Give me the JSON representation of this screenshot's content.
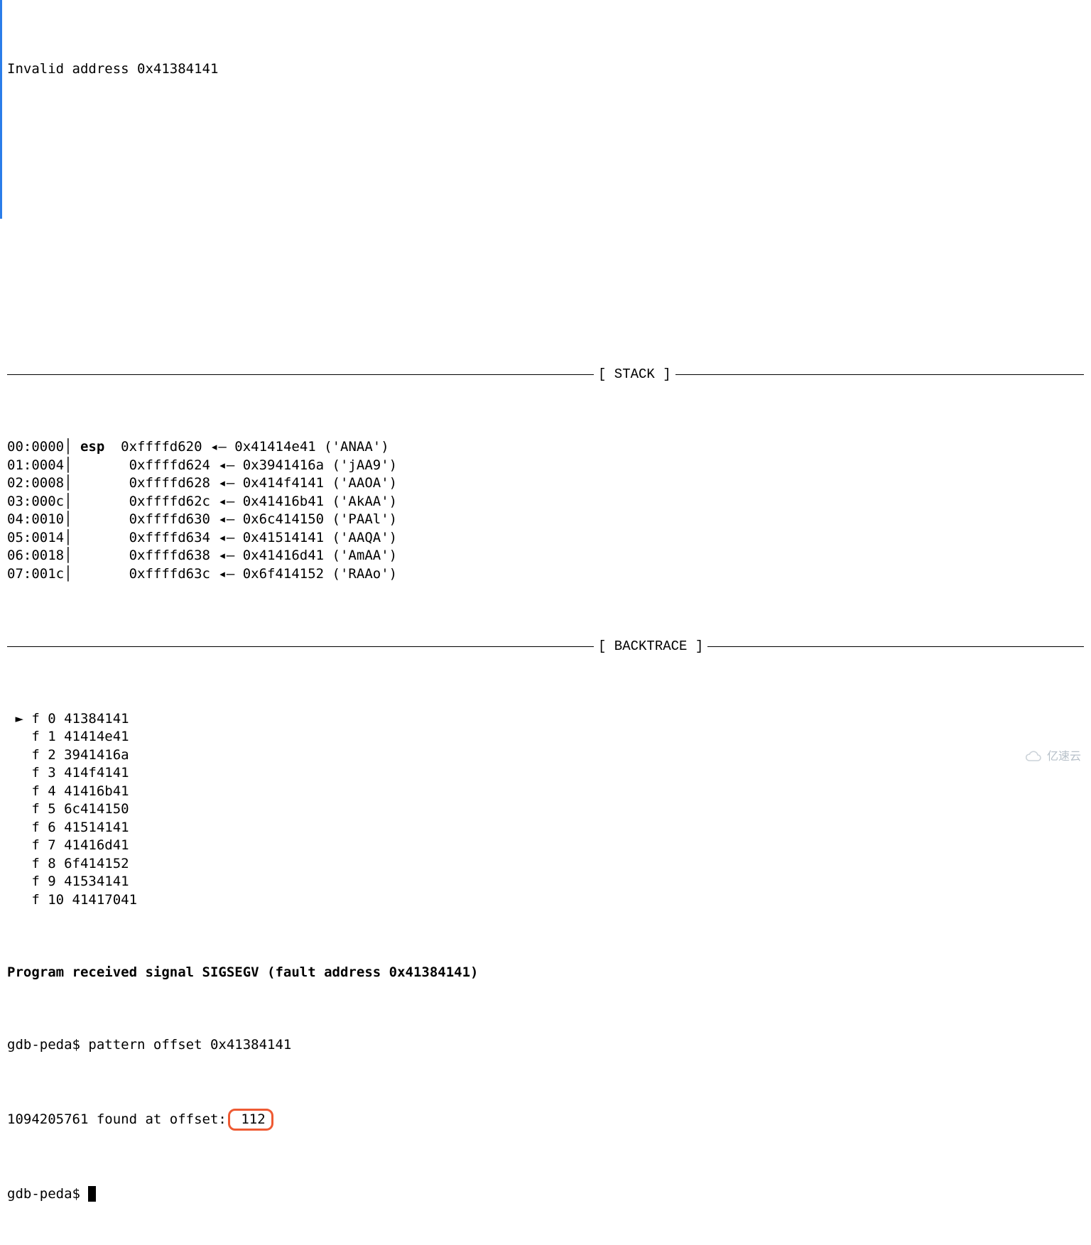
{
  "top": {
    "invalid_addr": "Invalid address 0x41384141"
  },
  "sections": {
    "stack": "[ STACK ]",
    "backtrace": "[ BACKTRACE ]"
  },
  "stack_reg": "esp",
  "stack_rows": [
    {
      "idx": "00:0000",
      "addr": "0xffffd620",
      "val": "0x41414e41",
      "ascii": "('ANAA')"
    },
    {
      "idx": "01:0004",
      "addr": "0xffffd624",
      "val": "0x3941416a",
      "ascii": "('jAA9')"
    },
    {
      "idx": "02:0008",
      "addr": "0xffffd628",
      "val": "0x414f4141",
      "ascii": "('AAOA')"
    },
    {
      "idx": "03:000c",
      "addr": "0xffffd62c",
      "val": "0x41416b41",
      "ascii": "('AkAA')"
    },
    {
      "idx": "04:0010",
      "addr": "0xffffd630",
      "val": "0x6c414150",
      "ascii": "('PAAl')"
    },
    {
      "idx": "05:0014",
      "addr": "0xffffd634",
      "val": "0x41514141",
      "ascii": "('AAQA')"
    },
    {
      "idx": "06:0018",
      "addr": "0xffffd638",
      "val": "0x41416d41",
      "ascii": "('AmAA')"
    },
    {
      "idx": "07:001c",
      "addr": "0xffffd63c",
      "val": "0x6f414152",
      "ascii": "('RAAo')"
    }
  ],
  "bt_marker": "►",
  "backtrace_rows": [
    {
      "n": "0",
      "val": "41384141"
    },
    {
      "n": "1",
      "val": "41414e41"
    },
    {
      "n": "2",
      "val": "3941416a"
    },
    {
      "n": "3",
      "val": "414f4141"
    },
    {
      "n": "4",
      "val": "41416b41"
    },
    {
      "n": "5",
      "val": "6c414150"
    },
    {
      "n": "6",
      "val": "41514141"
    },
    {
      "n": "7",
      "val": "41416d41"
    },
    {
      "n": "8",
      "val": "6f414152"
    },
    {
      "n": "9",
      "val": "41534141"
    },
    {
      "n": "10",
      "val": "41417041"
    }
  ],
  "signal_line": "Program received signal SIGSEGV (fault address 0x41384141)",
  "cmd1": {
    "prompt": "gdb-peda$ ",
    "text": "pattern offset 0x41384141"
  },
  "result": {
    "prefix": "1094205761 found at offset:",
    "highlight": "112"
  },
  "cmd2": {
    "prompt": "gdb-peda$ "
  },
  "watermark": "亿速云"
}
